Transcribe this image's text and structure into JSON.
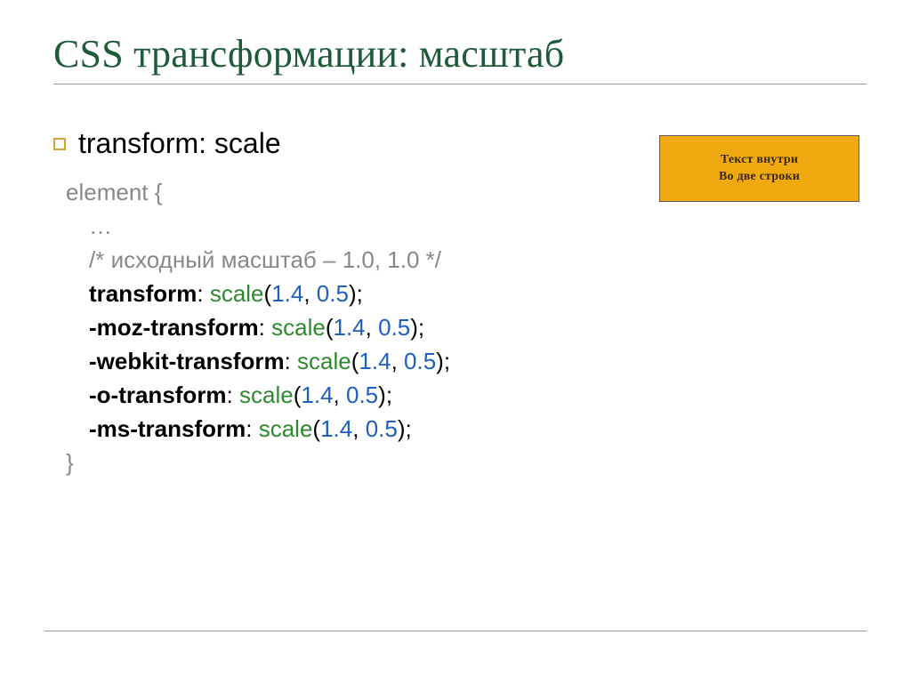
{
  "title": "CSS трансформации: масштаб",
  "bullet": "transform: scale",
  "demo": {
    "line1": "Текст внутри",
    "line2": "Во две строки"
  },
  "code": {
    "selector_open": "element {",
    "ellipsis": "…",
    "comment": "/* исходный масштаб – 1.0, 1.0 */",
    "props": [
      {
        "name": "transform",
        "func": "scale",
        "a": "1.4",
        "b": "0.5"
      },
      {
        "name": "-moz-transform",
        "func": "scale",
        "a": "1.4",
        "b": "0.5"
      },
      {
        "name": "-webkit-transform",
        "func": "scale",
        "a": "1.4",
        "b": "0.5"
      },
      {
        "name": "-o-transform",
        "func": "scale",
        "a": "1.4",
        "b": "0.5"
      },
      {
        "name": "-ms-transform",
        "func": "scale",
        "a": "1.4",
        "b": "0.5"
      }
    ],
    "close": "}"
  },
  "punct": {
    "colon_space": ": ",
    "paren_open": "(",
    "comma_space": ", ",
    "paren_close_semi": ");"
  }
}
